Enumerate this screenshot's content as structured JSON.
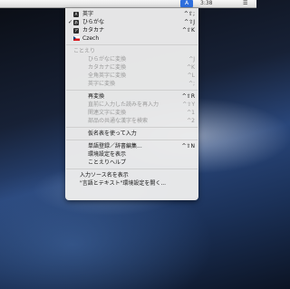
{
  "menubar": {
    "input_icon": "A",
    "clock": "3:38"
  },
  "menu": {
    "input_modes": [
      {
        "icon": "A",
        "label": "英字",
        "shortcut": "^⇧;",
        "checked": false
      },
      {
        "icon": "あ",
        "label": "ひらがな",
        "shortcut": "^⇧J",
        "checked": true
      },
      {
        "icon": "ア",
        "label": "カタカナ",
        "shortcut": "^⇧K",
        "checked": false
      },
      {
        "icon": "flag-czech",
        "label": "Czech",
        "shortcut": "",
        "checked": false
      }
    ],
    "kotoeri_header": "ことえり",
    "conversions": [
      {
        "label": "ひらがなに変換",
        "shortcut": "^J"
      },
      {
        "label": "カタカナに変換",
        "shortcut": "^K"
      },
      {
        "label": "全角英字に変換",
        "shortcut": "^L"
      },
      {
        "label": "英字に変換",
        "shortcut": "^;"
      }
    ],
    "reconvert": [
      {
        "label": "再変換",
        "shortcut": "^⇧R",
        "disabled": false
      },
      {
        "label": "直前に入力した読みを再入力",
        "shortcut": "^⇧Y",
        "disabled": true
      },
      {
        "label": "関連文字に変換",
        "shortcut": "^1",
        "disabled": true
      },
      {
        "label": "部品の共通な漢字を検索",
        "shortcut": "^2",
        "disabled": true
      }
    ],
    "kana_table": "仮名表を使って入力",
    "dictionary": [
      {
        "label": "単語登録／辞書編集...",
        "shortcut": "^⇧N"
      },
      {
        "label": "環境設定を表示",
        "shortcut": ""
      },
      {
        "label": "ことえりヘルプ",
        "shortcut": ""
      }
    ],
    "show_source_name": "入力ソース名を表示",
    "open_prefs": "\"言語とテキスト\"環境設定を開く..."
  }
}
